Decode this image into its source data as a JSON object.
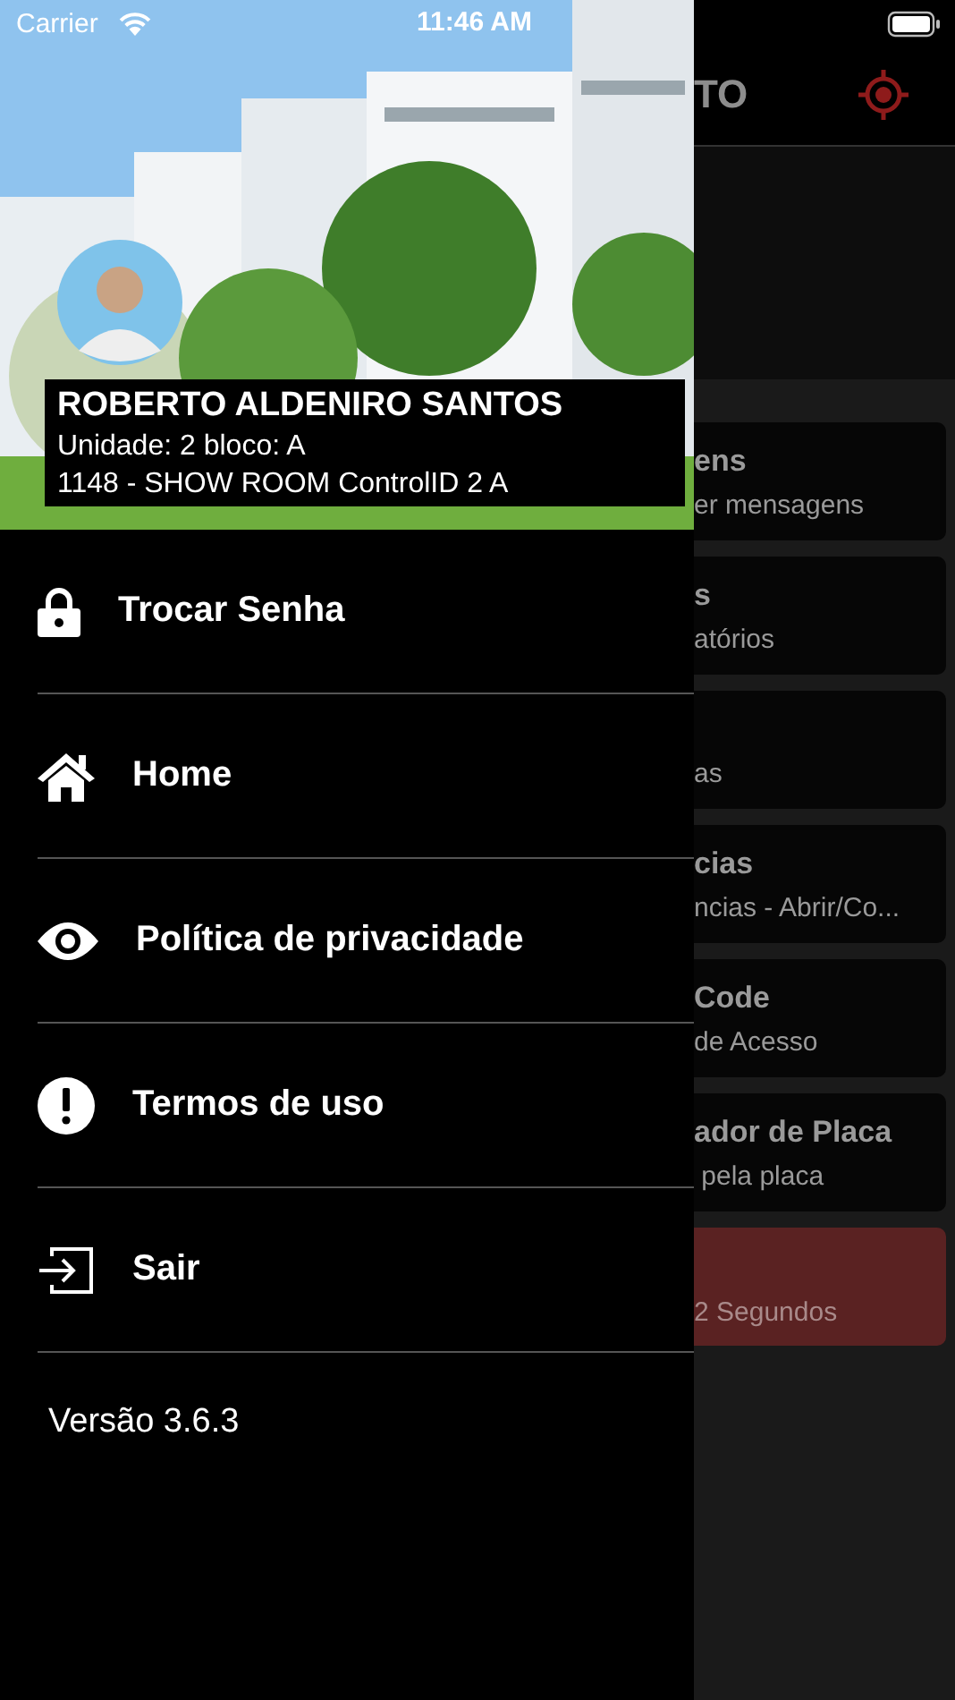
{
  "status_bar": {
    "carrier": "Carrier",
    "time": "11:46 AM"
  },
  "background_screen": {
    "header_title": "TO",
    "cards": [
      {
        "kind": "normal",
        "title": "ens",
        "subtitle": "er mensagens"
      },
      {
        "kind": "normal",
        "title": "s",
        "subtitle": "atórios"
      },
      {
        "kind": "normal",
        "subtitle": "as"
      },
      {
        "kind": "normal",
        "title": "cias",
        "subtitle": "ncias - Abrir/Co..."
      },
      {
        "kind": "normal",
        "title": "Code",
        "subtitle": "de Acesso"
      },
      {
        "kind": "normal",
        "title": "ador de Placa",
        "subtitle": " pela placa"
      },
      {
        "kind": "alert",
        "subtitle": "2 Segundos"
      }
    ]
  },
  "drawer": {
    "header": {
      "name": "ROBERTO ALDENIRO SANTOS",
      "unit": "Unidade: 2 bloco: A",
      "site": "1148 - SHOW ROOM ControlID 2 A"
    },
    "menu": [
      {
        "kind": "lock",
        "label": "Trocar Senha"
      },
      {
        "kind": "home",
        "label": "Home"
      },
      {
        "kind": "eye",
        "label": "Política de privacidade"
      },
      {
        "kind": "alert",
        "label": "Termos de uso"
      },
      {
        "kind": "exit",
        "label": "Sair"
      }
    ],
    "version": "Versão 3.6.3"
  }
}
